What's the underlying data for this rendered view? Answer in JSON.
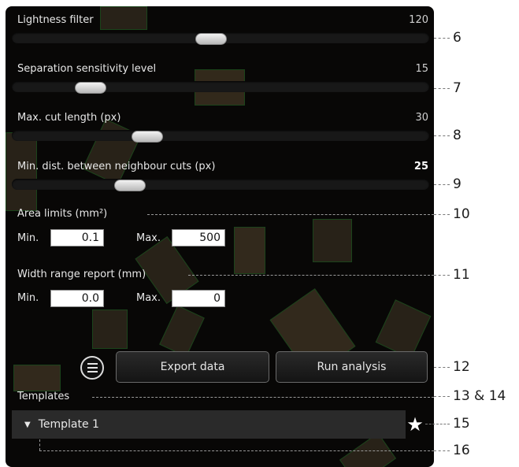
{
  "sliders": [
    {
      "label": "Lightness filter",
      "value": "120",
      "bold": false
    },
    {
      "label": "Separation sensitivity level",
      "value": "15",
      "bold": false
    },
    {
      "label": "Max. cut length (px)",
      "value": "30",
      "bold": false
    },
    {
      "label": "Min. dist. between neighbour cuts (px)",
      "value": "25",
      "bold": true
    }
  ],
  "area_limits": {
    "title": "Area limits (mm²)",
    "min_label": "Min.",
    "min_value": "0.1",
    "max_label": "Max.",
    "max_value": "500"
  },
  "width_range": {
    "title": "Width range report (mm)",
    "min_label": "Min.",
    "min_value": "0.0",
    "max_label": "Max.",
    "max_value": "0"
  },
  "buttons": {
    "export": "Export data",
    "run": "Run analysis"
  },
  "templates": {
    "title": "Templates",
    "item": "Template 1",
    "expand_icon": "▼",
    "favorite_icon": "★"
  },
  "callouts": [
    "6",
    "7",
    "8",
    "9",
    "10",
    "11",
    "12",
    "13 & 14",
    "15",
    "16"
  ]
}
